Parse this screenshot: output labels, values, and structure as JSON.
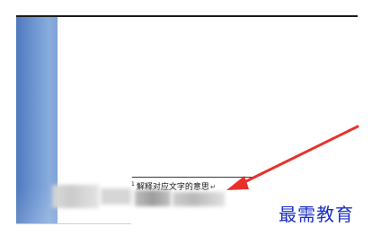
{
  "document": {
    "footnote": {
      "marker": "1",
      "text": "解释对应文字的意思",
      "paragraph_mark": "↵"
    }
  },
  "overlay": {
    "arrow_color": "#e8312a",
    "watermark": "最需教育",
    "watermark_color": "#1a2fc8"
  },
  "colors": {
    "left_bar": "#6f97d2",
    "rule": "#1a1a1a"
  }
}
